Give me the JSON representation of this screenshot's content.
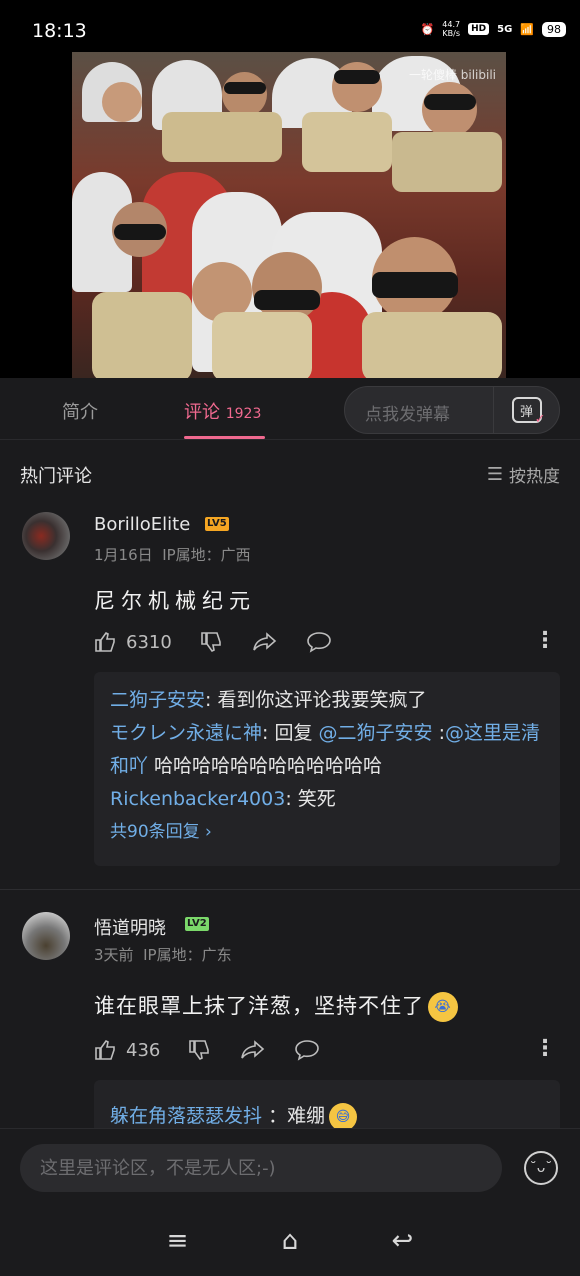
{
  "status": {
    "time": "18:13",
    "speed": "44.7",
    "speed_unit": "KB/s",
    "hd": "HD",
    "network": "5G",
    "battery": "98"
  },
  "video": {
    "watermark": "一轮傻棒 bilibili"
  },
  "tabs": {
    "intro": "简介",
    "comments": "评论",
    "comments_count": "1923"
  },
  "danmaku": {
    "placeholder": "点我发弹幕",
    "icon_label": "弹"
  },
  "section": {
    "title": "热门评论",
    "sort": "按热度"
  },
  "comments": [
    {
      "user": "BorilloElite",
      "level": "LV5",
      "level_color": "#f5a623",
      "date": "1月16日",
      "ip": "IP属地：广西",
      "text": "尼尔机械纪元",
      "likes": "6310",
      "replies": [
        {
          "user": "二狗子安安",
          "text": "看到你这评论我要笑疯了"
        },
        {
          "user": "モクレン永遠に神",
          "prefix": "回复 ",
          "mention": "@二狗子安安",
          "sep": " :",
          "mention2": "@这里是清和吖",
          "text": " 哈哈哈哈哈哈哈哈哈哈哈哈"
        },
        {
          "user": "Rickenbacker4003",
          "text": "笑死"
        }
      ],
      "more_replies": "共90条回复 ›"
    },
    {
      "user": "悟道明晓",
      "level": "LV2",
      "level_color": "#7bd86a",
      "date": "3天前",
      "ip": "IP属地：广东",
      "text": "谁在眼罩上抹了洋葱，坚持不住了",
      "likes": "436",
      "replies": [
        {
          "user": "躲在角落瑟瑟发抖",
          "text": "：难绷"
        }
      ]
    }
  ],
  "input": {
    "placeholder": "这里是评论区，不是无人区;-)"
  },
  "nav": {
    "menu": "≡",
    "home": "⌂",
    "back": "↩"
  }
}
